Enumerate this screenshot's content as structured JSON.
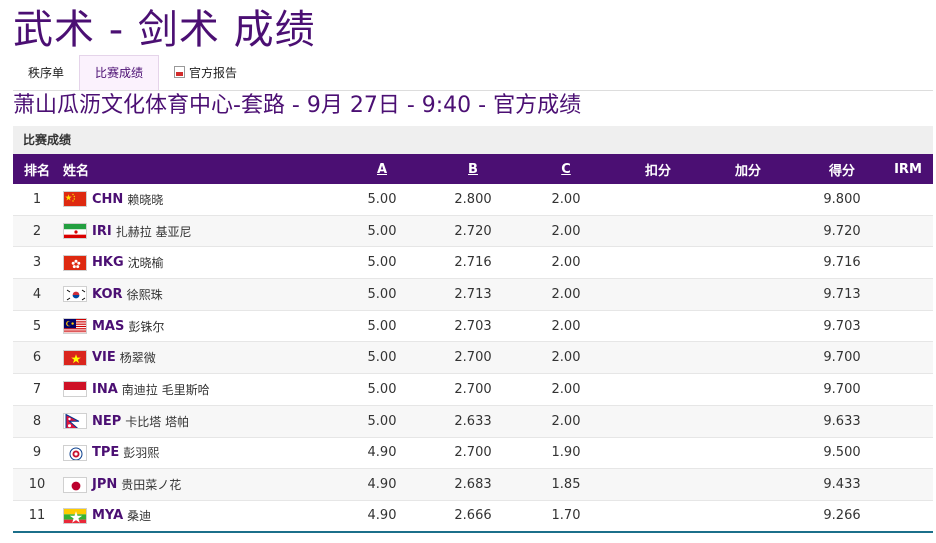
{
  "page": {
    "title": "武术 - 剑术 成绩",
    "subtitle": "萧山瓜沥文化体育中心-套路 - 9月 27日 - 9:40 - 官方成绩"
  },
  "tabs": [
    {
      "label": "秩序单"
    },
    {
      "label": "比赛成绩"
    },
    {
      "label": "官方报告"
    }
  ],
  "section": {
    "title": "比赛成绩"
  },
  "table": {
    "headers": {
      "rank": "排名",
      "name": "姓名",
      "a": "A",
      "b": "B",
      "c": "C",
      "deduction": "扣分",
      "addition": "加分",
      "score": "得分",
      "irm": "IRM"
    },
    "rows": [
      {
        "rank": "1",
        "flag": "chn",
        "noc": "CHN",
        "athlete": "赖晓晓",
        "a": "5.00",
        "b": "2.800",
        "c": "2.00",
        "score": "9.800"
      },
      {
        "rank": "2",
        "flag": "iri",
        "noc": "IRI",
        "athlete": "扎赫拉 基亚尼",
        "a": "5.00",
        "b": "2.720",
        "c": "2.00",
        "score": "9.720"
      },
      {
        "rank": "3",
        "flag": "hkg",
        "noc": "HKG",
        "athlete": "沈晓榆",
        "a": "5.00",
        "b": "2.716",
        "c": "2.00",
        "score": "9.716"
      },
      {
        "rank": "4",
        "flag": "kor",
        "noc": "KOR",
        "athlete": "徐熙珠",
        "a": "5.00",
        "b": "2.713",
        "c": "2.00",
        "score": "9.713"
      },
      {
        "rank": "5",
        "flag": "mas",
        "noc": "MAS",
        "athlete": "彭铢尔",
        "a": "5.00",
        "b": "2.703",
        "c": "2.00",
        "score": "9.703"
      },
      {
        "rank": "6",
        "flag": "vie",
        "noc": "VIE",
        "athlete": "杨翠微",
        "a": "5.00",
        "b": "2.700",
        "c": "2.00",
        "score": "9.700"
      },
      {
        "rank": "7",
        "flag": "ina",
        "noc": "INA",
        "athlete": "南迪拉 毛里斯哈",
        "a": "5.00",
        "b": "2.700",
        "c": "2.00",
        "score": "9.700"
      },
      {
        "rank": "8",
        "flag": "nep",
        "noc": "NEP",
        "athlete": "卡比塔 塔帕",
        "a": "5.00",
        "b": "2.633",
        "c": "2.00",
        "score": "9.633"
      },
      {
        "rank": "9",
        "flag": "tpe",
        "noc": "TPE",
        "athlete": "彭羽熙",
        "a": "4.90",
        "b": "2.700",
        "c": "1.90",
        "score": "9.500"
      },
      {
        "rank": "10",
        "flag": "jpn",
        "noc": "JPN",
        "athlete": "贵田菜ノ花",
        "a": "4.90",
        "b": "2.683",
        "c": "1.85",
        "score": "9.433"
      },
      {
        "rank": "11",
        "flag": "mya",
        "noc": "MYA",
        "athlete": "桑迪",
        "a": "4.90",
        "b": "2.666",
        "c": "1.70",
        "score": "9.266"
      }
    ]
  }
}
